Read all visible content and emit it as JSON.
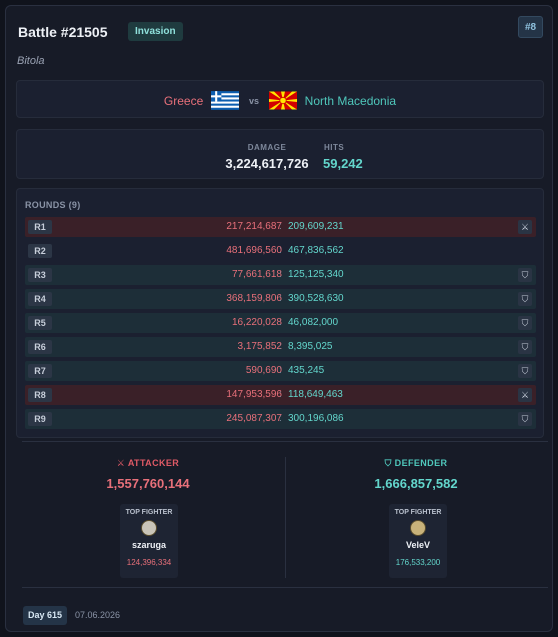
{
  "battle": {
    "title": "Battle #21505",
    "type_badge": "Invasion",
    "number_badge": "#8",
    "region": "Bitola"
  },
  "matchup": {
    "attacker": "Greece",
    "vs": "vs",
    "defender": "North Macedonia",
    "attacker_flag": "greece-flag",
    "defender_flag": "north-macedonia-flag"
  },
  "stats": {
    "damage_label": "DAMAGE",
    "damage_value": "3,224,617,726",
    "hits_label": "HITS",
    "hits_value": "59,242"
  },
  "rounds": {
    "title": "ROUNDS (9)",
    "items": [
      {
        "label": "R1",
        "attacker": "217,214,687",
        "defender": "209,609,231",
        "winner": "attacker",
        "icon": "swords-icon"
      },
      {
        "label": "R2",
        "attacker": "481,696,560",
        "defender": "467,836,562",
        "winner": "none",
        "icon": ""
      },
      {
        "label": "R3",
        "attacker": "77,661,618",
        "defender": "125,125,340",
        "winner": "defender",
        "icon": "shield-icon"
      },
      {
        "label": "R4",
        "attacker": "368,159,806",
        "defender": "390,528,630",
        "winner": "defender",
        "icon": "shield-icon"
      },
      {
        "label": "R5",
        "attacker": "16,220,028",
        "defender": "46,082,000",
        "winner": "defender",
        "icon": "shield-icon"
      },
      {
        "label": "R6",
        "attacker": "3,175,852",
        "defender": "8,395,025",
        "winner": "defender",
        "icon": "shield-icon"
      },
      {
        "label": "R7",
        "attacker": "590,690",
        "defender": "435,245",
        "winner": "defender",
        "icon": "shield-icon"
      },
      {
        "label": "R8",
        "attacker": "147,953,596",
        "defender": "118,649,463",
        "winner": "attacker",
        "icon": "swords-icon"
      },
      {
        "label": "R9",
        "attacker": "245,087,307",
        "defender": "300,196,086",
        "winner": "defender",
        "icon": "shield-icon"
      }
    ],
    "separator": ":"
  },
  "attacker_side": {
    "label": "ATTACKER",
    "total": "1,557,760,144",
    "top_fighter_label": "TOP FIGHTER",
    "top_fighter_name": "szaruga",
    "top_fighter_damage": "124,396,334"
  },
  "defender_side": {
    "label": "DEFENDER",
    "total": "1,666,857,582",
    "top_fighter_label": "TOP FIGHTER",
    "top_fighter_name": "VeleV",
    "top_fighter_damage": "176,533,200"
  },
  "footer": {
    "day": "Day 615",
    "date": "07.06.2026"
  },
  "colors": {
    "attacker": "#e8707a",
    "defender": "#63d6cc",
    "background": "#171b27"
  }
}
